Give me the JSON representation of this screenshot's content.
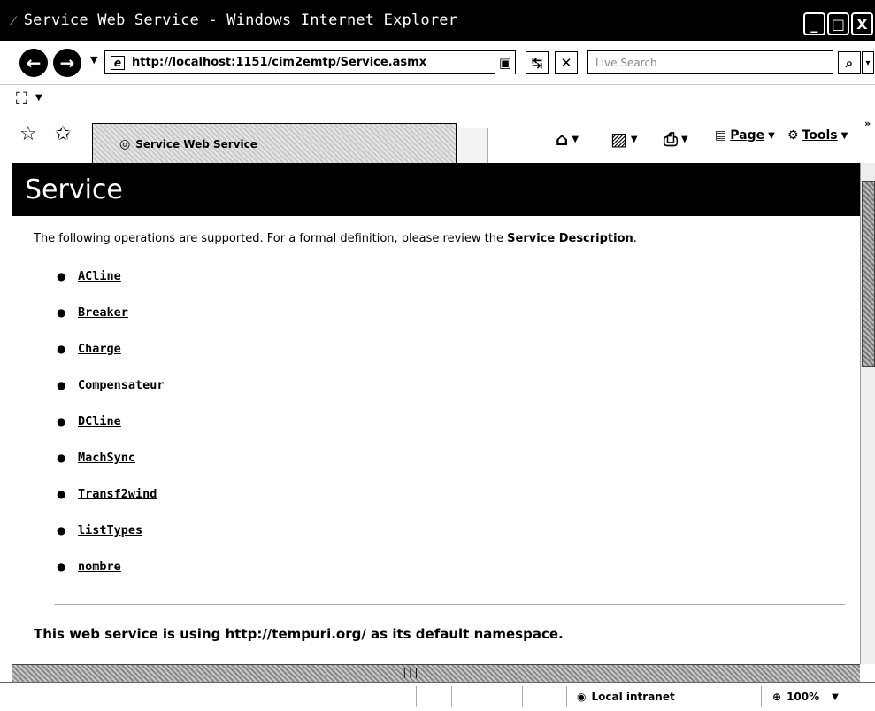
{
  "window": {
    "title": "Service Web Service - Windows Internet Explorer",
    "controls": [
      "_",
      "□",
      "X"
    ]
  },
  "address": {
    "url": "http://localhost:1151/cim2emtp/Service.asmx",
    "search_placeholder": "Live Search"
  },
  "tab": {
    "label": "Service Web Service"
  },
  "commands": {
    "page": "Page",
    "tools": "Tools"
  },
  "page": {
    "heading": "Service",
    "intro_text": "The following operations are supported. For a formal definition, please review the ",
    "intro_link": "Service Description",
    "intro_end": ".",
    "operations": [
      "ACline",
      "Breaker",
      "Charge",
      "Compensateur",
      "DCline",
      "MachSync",
      "Transf2wind",
      "listTypes",
      "nombre"
    ],
    "namespace_line": "This web service is using http://tempuri.org/ as its default namespace."
  },
  "status": {
    "zone": "Local intranet",
    "zoom": "100%"
  }
}
